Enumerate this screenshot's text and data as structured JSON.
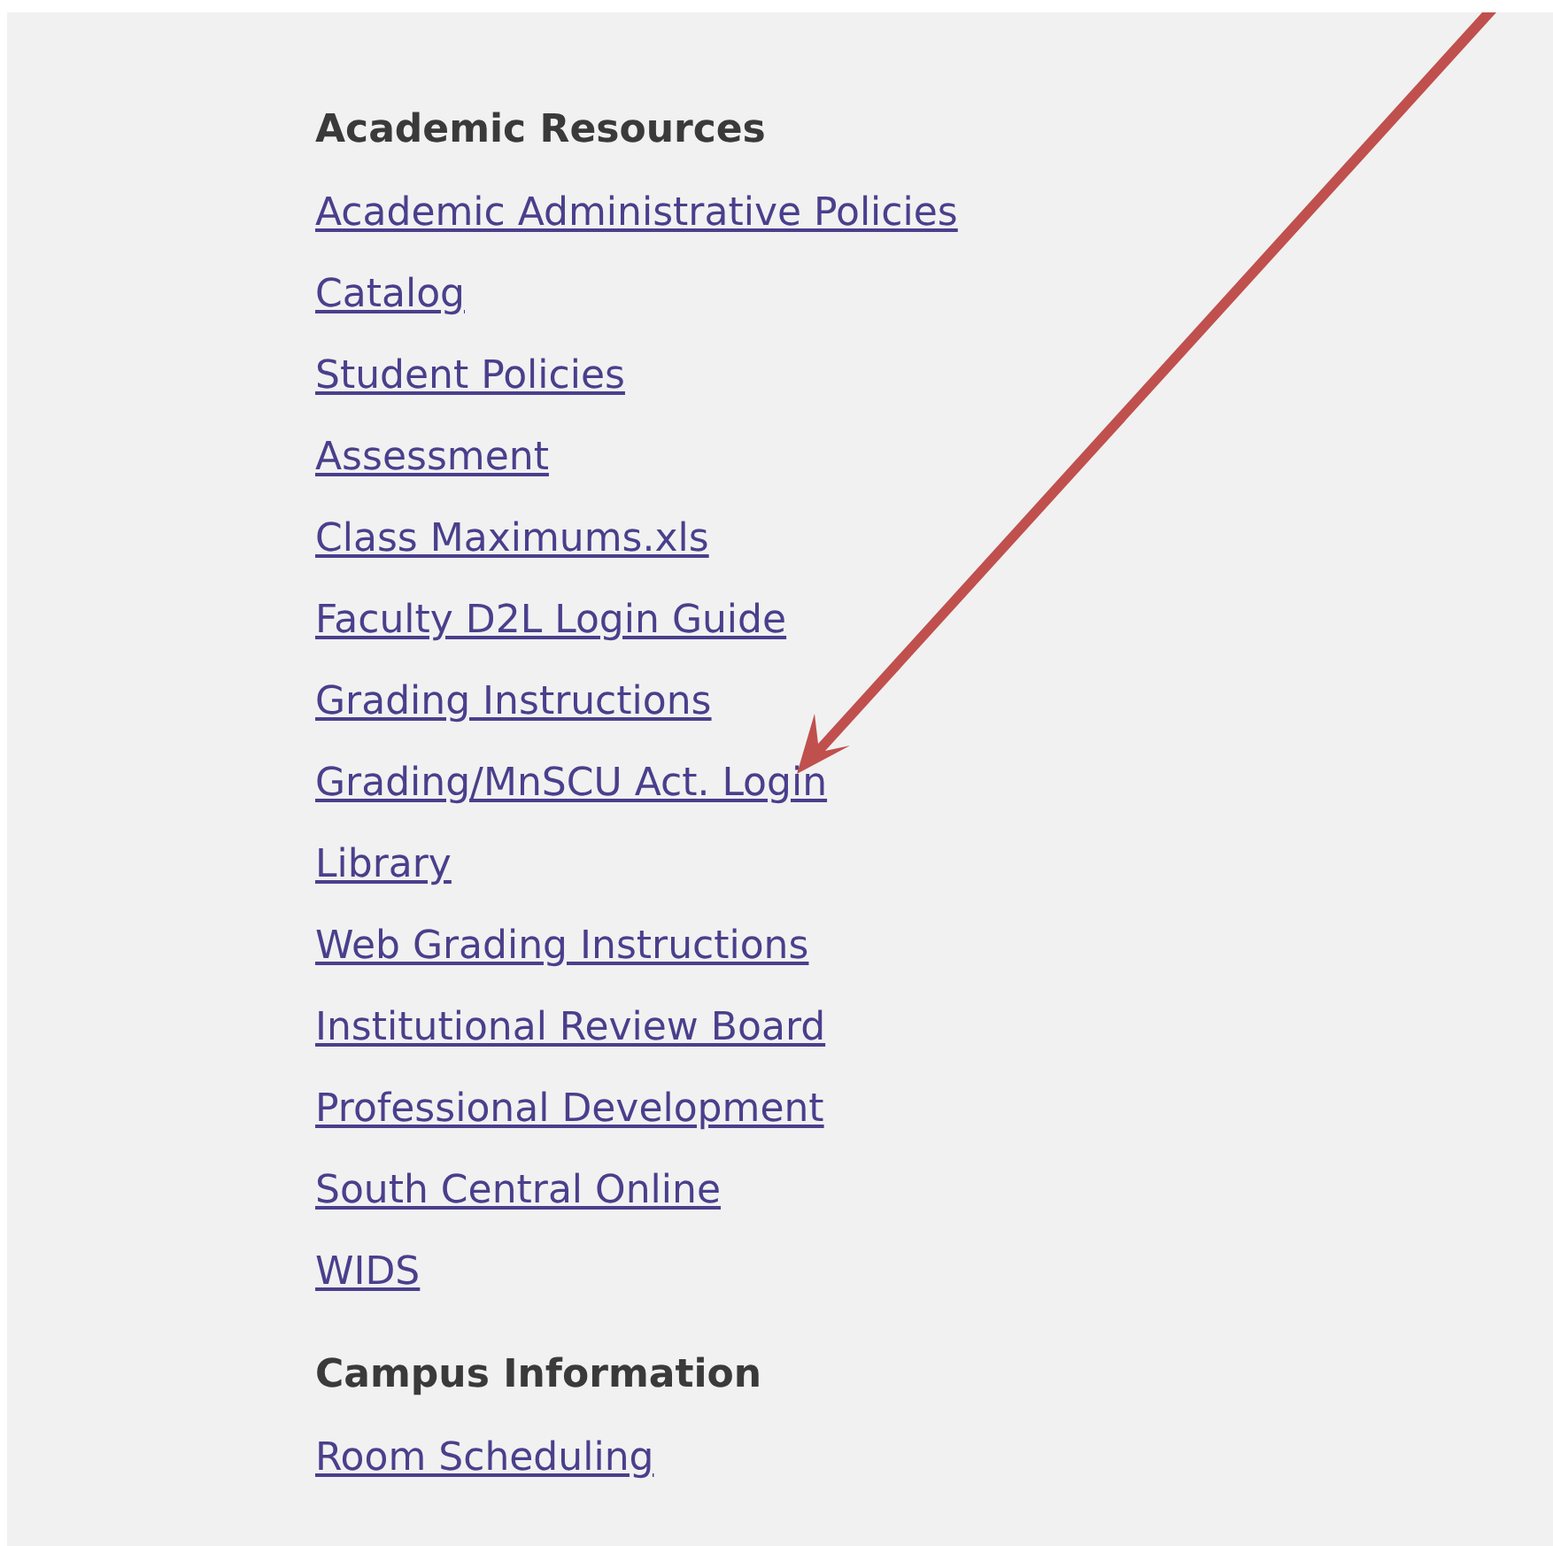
{
  "sections": [
    {
      "heading": "Academic Resources",
      "links": [
        "Academic Administrative Policies",
        "Catalog",
        "Student Policies",
        "Assessment",
        "Class Maximums.xls",
        "Faculty D2L Login Guide",
        "Grading Instructions",
        "Grading/MnSCU Act. Login",
        "Library",
        "Web Grading Instructions",
        "Institutional Review Board",
        "Professional Development",
        "South Central Online",
        "WIDS"
      ]
    },
    {
      "heading": "Campus Information",
      "links": [
        "Room Scheduling"
      ]
    }
  ]
}
